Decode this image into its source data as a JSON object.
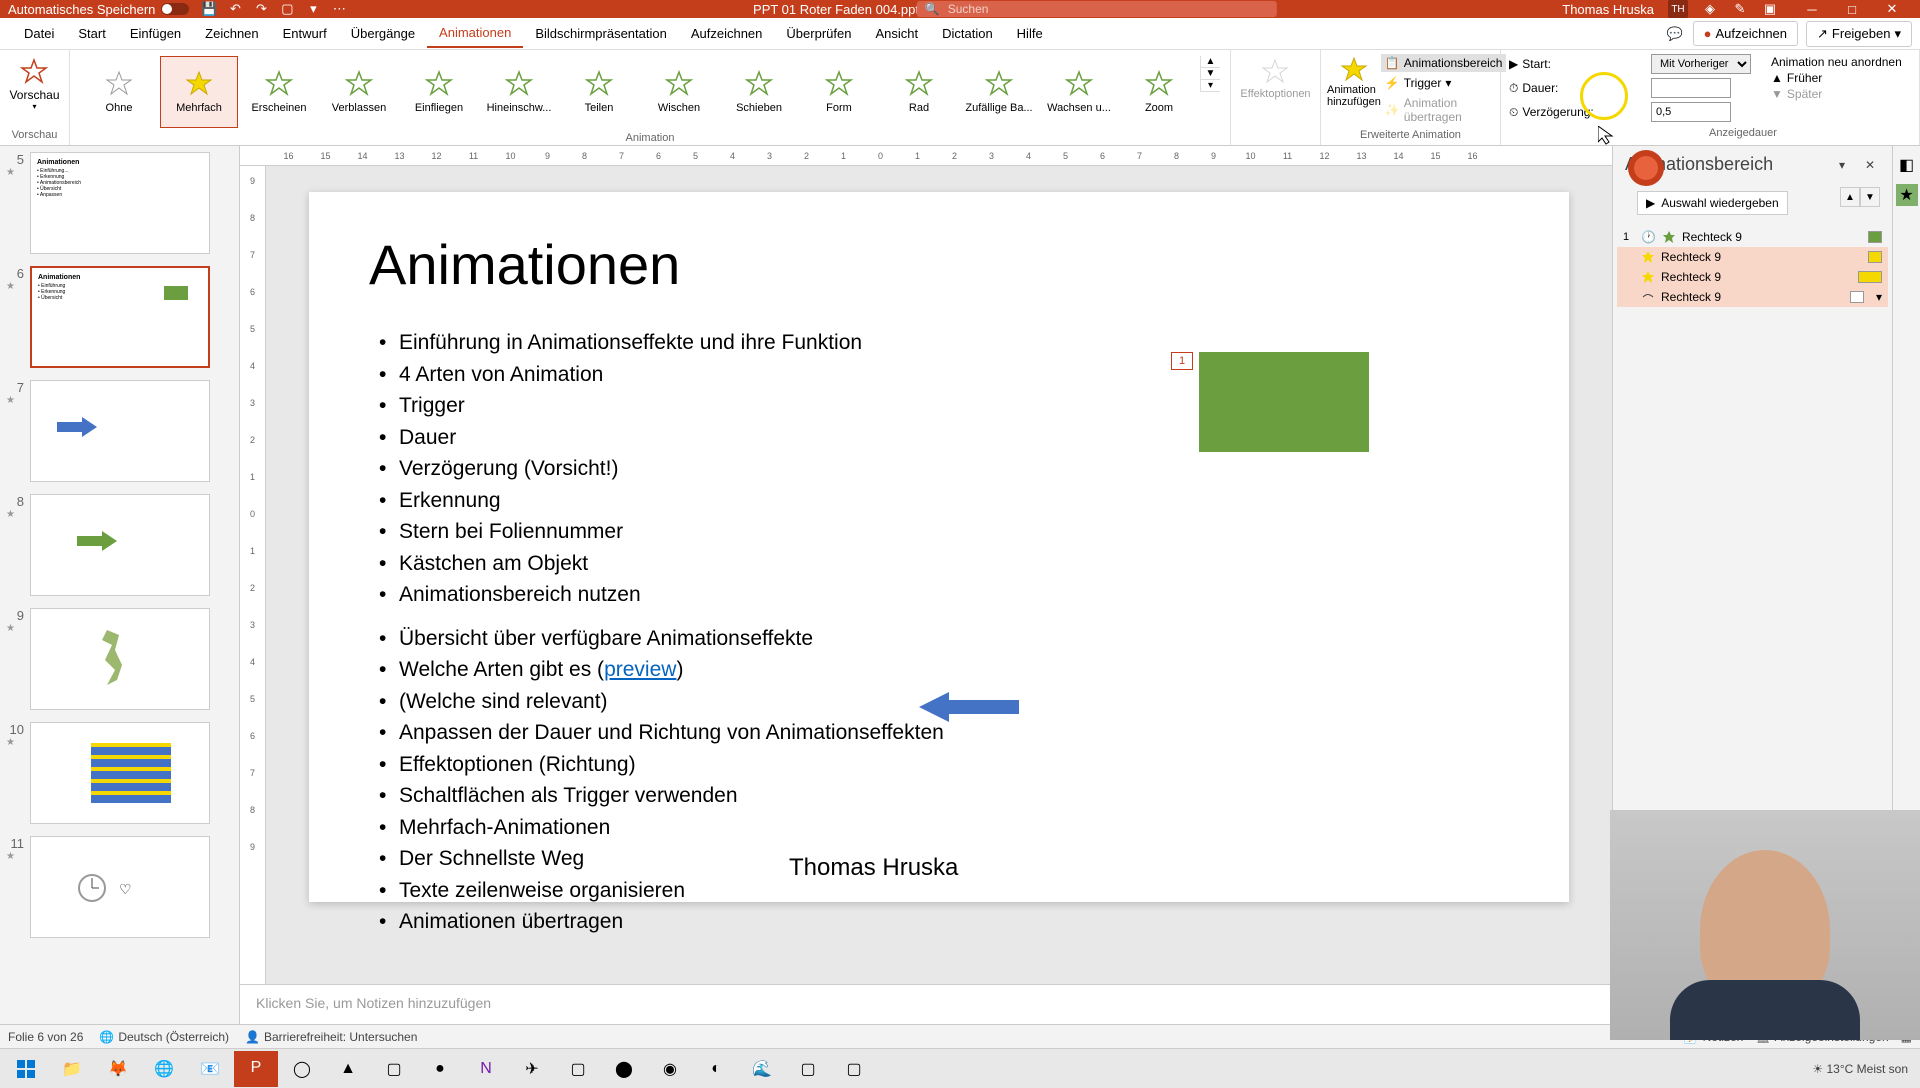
{
  "titlebar": {
    "autosave": "Automatisches Speichern",
    "filename": "PPT 01 Roter Faden 004.pptx",
    "search_placeholder": "Suchen",
    "username": "Thomas Hruska",
    "user_initials": "TH"
  },
  "tabs": {
    "datei": "Datei",
    "start": "Start",
    "einfuegen": "Einfügen",
    "zeichnen": "Zeichnen",
    "entwurf": "Entwurf",
    "uebergaenge": "Übergänge",
    "animationen": "Animationen",
    "bildschirm": "Bildschirmpräsentation",
    "aufzeichnen": "Aufzeichnen",
    "ueberpruefen": "Überprüfen",
    "ansicht": "Ansicht",
    "dictation": "Dictation",
    "hilfe": "Hilfe",
    "aufzeichnen_action": "Aufzeichnen",
    "freigeben": "Freigeben"
  },
  "ribbon": {
    "vorschau": "Vorschau",
    "vorschau_group": "Vorschau",
    "anim_gallery": [
      "Ohne",
      "Mehrfach",
      "Erscheinen",
      "Verblassen",
      "Einfliegen",
      "Hineinschw...",
      "Teilen",
      "Wischen",
      "Schieben",
      "Form",
      "Rad",
      "Zufällige Ba...",
      "Wachsen u...",
      "Zoom"
    ],
    "animation_group": "Animation",
    "effektoptionen": "Effektoptionen",
    "hinzufuegen": "Animation hinzufügen",
    "animationsbereich": "Animationsbereich",
    "trigger": "Trigger",
    "uebertragen": "Animation übertragen",
    "erweiterte_group": "Erweiterte Animation",
    "start_label": "Start:",
    "start_value": "Mit Vorheriger",
    "dauer_label": "Dauer:",
    "dauer_value": "",
    "verzoegerung_label": "Verzögerung:",
    "verzoegerung_value": "0,5",
    "neu_anordnen": "Animation neu anordnen",
    "frueher": "Früher",
    "spaeter": "Später",
    "anzeigedauer_group": "Anzeigedauer"
  },
  "ruler_h": [
    "16",
    "15",
    "14",
    "13",
    "12",
    "11",
    "10",
    "9",
    "8",
    "7",
    "6",
    "5",
    "4",
    "3",
    "2",
    "1",
    "0",
    "1",
    "2",
    "3",
    "4",
    "5",
    "6",
    "7",
    "8",
    "9",
    "10",
    "11",
    "12",
    "13",
    "14",
    "15",
    "16"
  ],
  "ruler_v": [
    "9",
    "8",
    "7",
    "6",
    "5",
    "4",
    "3",
    "2",
    "1",
    "0",
    "1",
    "2",
    "3",
    "4",
    "5",
    "6",
    "7",
    "8",
    "9"
  ],
  "thumbs": [
    {
      "num": "5"
    },
    {
      "num": "6"
    },
    {
      "num": "7"
    },
    {
      "num": "8"
    },
    {
      "num": "9"
    },
    {
      "num": "10"
    },
    {
      "num": "11"
    }
  ],
  "slide": {
    "title": "Animationen",
    "b1": "Einführung in Animationseffekte und ihre Funktion",
    "b1a": "4 Arten von Animation",
    "b1b": "Trigger",
    "b1c": "Dauer",
    "b1d": "Verzögerung (Vorsicht!)",
    "b2": "Erkennung",
    "b2a": "Stern bei Foliennummer",
    "b2b": "Kästchen am Objekt",
    "b3": "Animationsbereich nutzen",
    "b4": "Übersicht über verfügbare Animationseffekte",
    "b4a_pre": "Welche Arten gibt es (",
    "b4a_link": "preview",
    "b4a_post": ")",
    "b4b": "(Welche sind relevant)",
    "b5": "Anpassen der Dauer und Richtung von Animationseffekten",
    "b5a": "Effektoptionen (Richtung)",
    "b5b": "Schaltflächen als Trigger verwenden",
    "b6": "Mehrfach-Animationen",
    "b7": "Der Schnellste Weg",
    "b7a": "Texte zeilenweise organisieren",
    "b8": "Animationen übertragen",
    "author": "Thomas Hruska",
    "badge": "1"
  },
  "notes": "Klicken Sie, um Notizen hinzuzufügen",
  "anim_pane": {
    "title": "Animationsbereich",
    "play": "Auswahl wiedergeben",
    "entries": [
      {
        "num": "1",
        "name": "Rechteck 9",
        "color": "#6a9e3f",
        "type": "entrance"
      },
      {
        "num": "",
        "name": "Rechteck 9",
        "color": "#f5d800",
        "type": "emphasis"
      },
      {
        "num": "",
        "name": "Rechteck 9",
        "color": "#f5d800",
        "type": "emphasis"
      },
      {
        "num": "",
        "name": "Rechteck 9",
        "color": "#fff",
        "type": "motion"
      }
    ]
  },
  "statusbar": {
    "slide_info": "Folie 6 von 26",
    "language": "Deutsch (Österreich)",
    "accessibility": "Barrierefreiheit: Untersuchen",
    "notizen": "Notizen",
    "anzeige": "Anzeigeeinstellungen"
  },
  "taskbar": {
    "weather": "13°C  Meist son"
  }
}
